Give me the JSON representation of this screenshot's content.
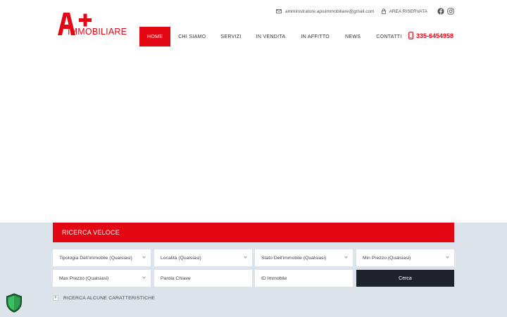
{
  "brand": {
    "logo_mark": "A+",
    "logo_text": "IMMOBILIARE",
    "accent_color": "#e30613"
  },
  "topbar": {
    "email": "amministratore.apiuimmobiliare@gmail.com",
    "email_icon": "mail-icon",
    "reserved_area": "AREA RISERVATA",
    "reserved_icon": "lock-icon",
    "social": [
      "facebook-icon",
      "instagram-icon"
    ]
  },
  "nav": {
    "items": [
      {
        "label": "HOME",
        "active": true
      },
      {
        "label": "CHI SIAMO"
      },
      {
        "label": "SERVIZI"
      },
      {
        "label": "IN VENDITA"
      },
      {
        "label": "IN AFFITTO"
      },
      {
        "label": "NEWS"
      },
      {
        "label": "CONTATTI"
      }
    ],
    "phone": "335-6454958"
  },
  "search": {
    "title": "RICERCA VELOCE",
    "fields": {
      "tipologia": "Tipologia Dell'immobile (Qualsiasi)",
      "localita": "Località (Qualsiasi)",
      "stato": "Stato Dell'immobile (Qualsiasi)",
      "min_prezzo": "Min Prezzo (Qualsiasi)",
      "max_prezzo": "Max Prezzo (Qualsiasi)",
      "parola_chiave": "Parola Chiave",
      "id_immobile": "ID Immobile"
    },
    "submit": "Cerca",
    "features_toggle": "RICERCA ALCUNE CARATTERISTICHE",
    "features_icon": "plus-icon"
  },
  "badge": {
    "icon": "shield-check-icon",
    "color": "#2e9e4f"
  }
}
